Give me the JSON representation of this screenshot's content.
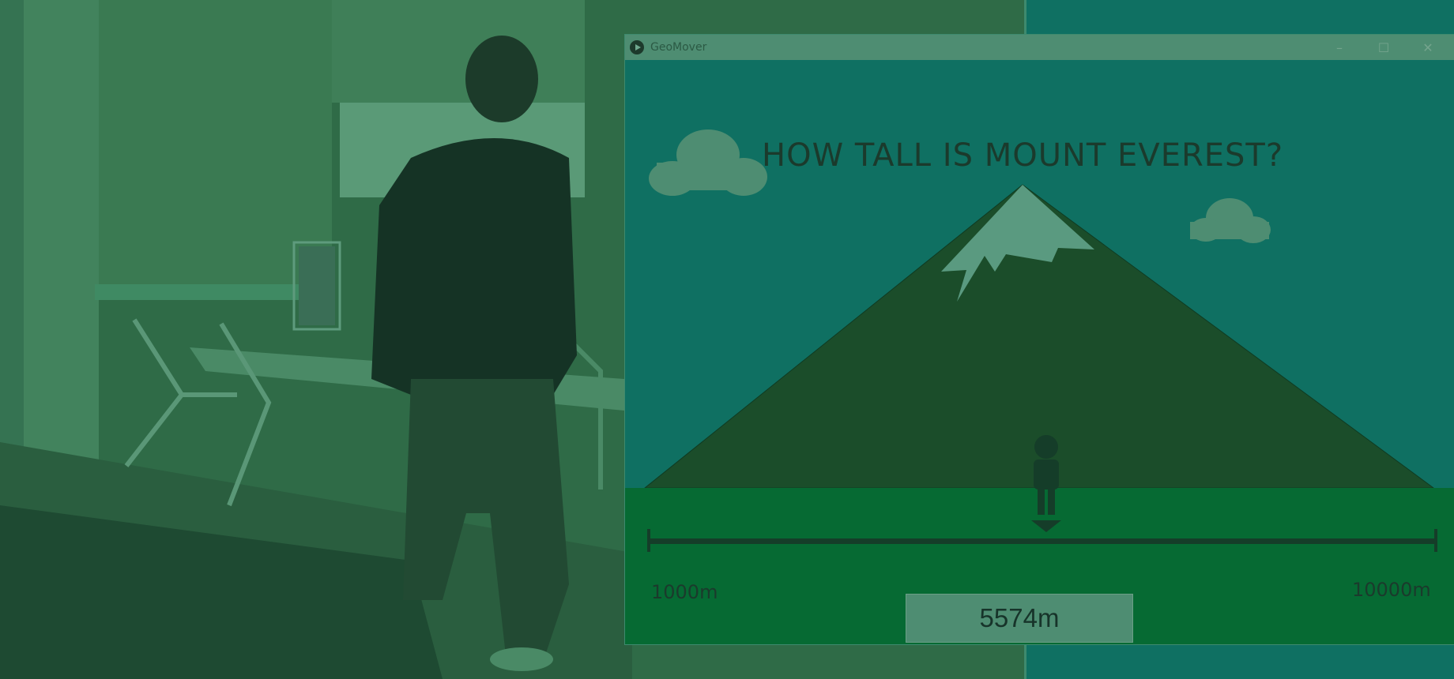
{
  "window": {
    "title": "GeoMover",
    "minimize_glyph": "–",
    "maximize_glyph": "☐",
    "close_glyph": "✕"
  },
  "game": {
    "question": "HOW TALL IS MOUNT EVEREST?",
    "scale_min_label": "1000m",
    "scale_max_label": "10000m",
    "current_answer": "5574m",
    "scale_min_value": 1000,
    "scale_max_value": 10000,
    "current_value": 5574
  },
  "colors": {
    "overlay_green": "#2f6b47",
    "sky": "#0f7062",
    "mountain": "#1b4d2a",
    "snow": "#5a9a80",
    "ground": "#066a33",
    "text_dark": "#1b3a2c"
  }
}
